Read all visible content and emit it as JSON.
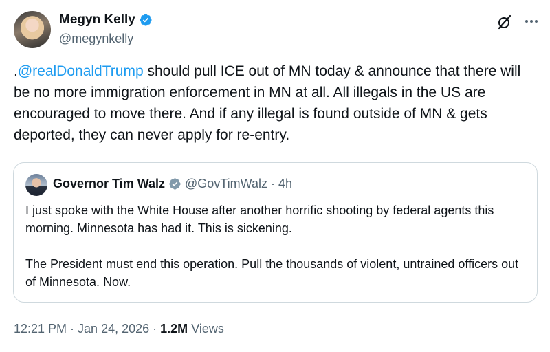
{
  "author": {
    "name": "Megyn Kelly",
    "handle": "@megynkelly"
  },
  "tweet": {
    "prefix": ".",
    "mention": "@realDonaldTrump",
    "body": " should pull ICE out of MN today & announce that there will be no more immigration enforcement in MN at all. All illegals in the US are encouraged to move there. And if any illegal is found outside of MN & gets deported, they can never apply for re-entry."
  },
  "quote": {
    "name": "Governor Tim Walz",
    "handle": "@GovTimWalz",
    "separator": "·",
    "time": "4h",
    "paragraph1": "I just spoke with the White House after another horrific shooting by federal agents this morning. Minnesota has had it. This is sickening.",
    "paragraph2": "The President must end this operation. Pull the thousands of violent, untrained officers out of Minnesota. Now."
  },
  "meta": {
    "time": "12:21 PM",
    "sep1": "·",
    "date": "Jan 24, 2026",
    "sep2": "·",
    "views_count": "1.2M",
    "views_label": "Views"
  },
  "icons": {
    "author_badge": "verified-badge-blue",
    "quote_badge": "verified-badge-gray",
    "grok": "grok-icon",
    "more": "more-icon"
  },
  "colors": {
    "link": "#1d9bf0",
    "secondary_text": "#536471",
    "verified_blue": "#1d9bf0",
    "verified_gray": "#829aab",
    "border": "#cfd9de"
  }
}
